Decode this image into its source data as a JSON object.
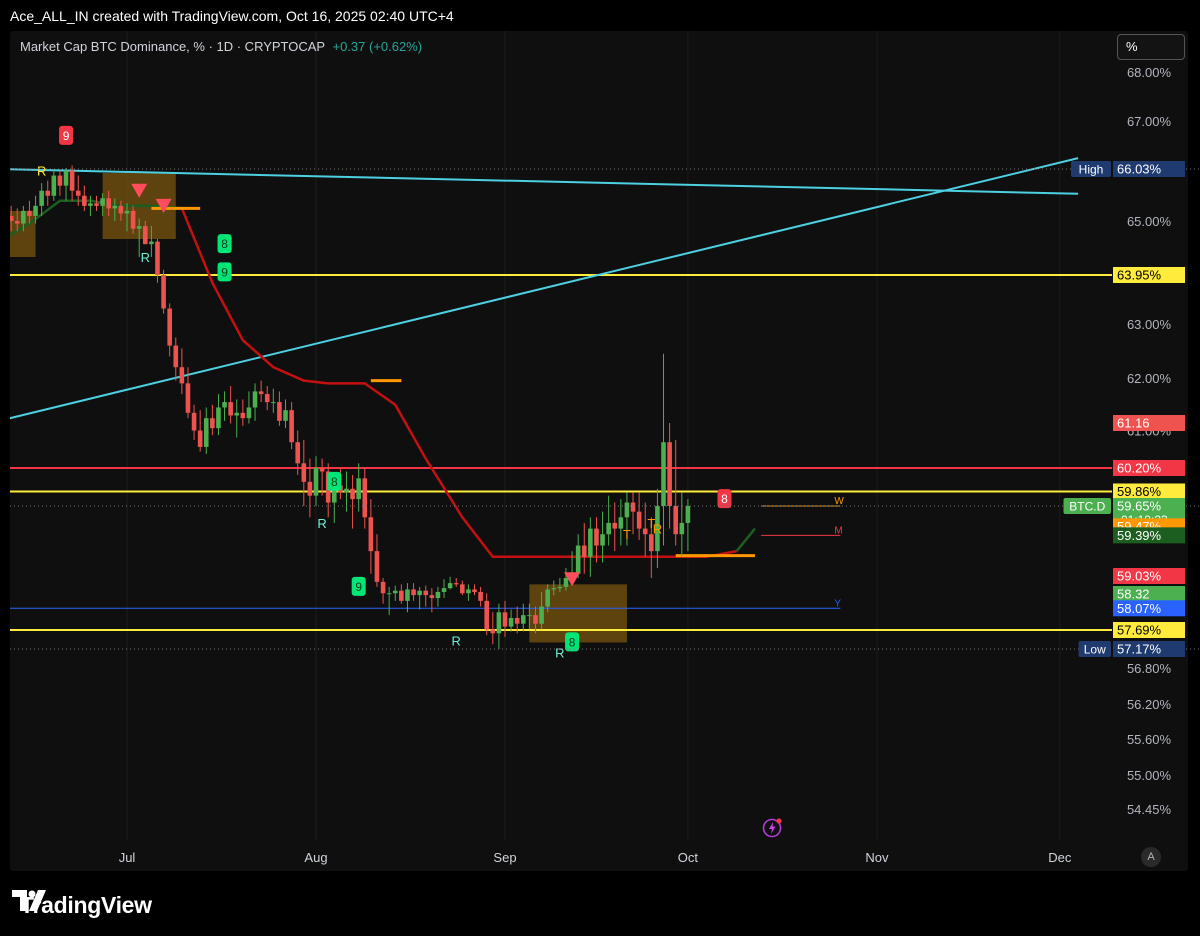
{
  "header": {
    "credit": "Ace_ALL_IN created with TradingView.com, Oct 16, 2025 02:40 UTC+4"
  },
  "legend": {
    "text": "Market Cap BTC Dominance, % · 1D · CRYPTOCAP",
    "change": "+0.37 (+0.62%)"
  },
  "toolbar": {
    "unit_label": "%",
    "auto_label": "A"
  },
  "brand": {
    "name": "TradingView"
  },
  "colors": {
    "background": "#0f0f0f",
    "up": "#4caf50",
    "down": "#ef5350",
    "trendline": "#4dd0e1",
    "yellow_level": "#ffeb3b",
    "red_level": "#f23645",
    "ma_red": "#c41010",
    "ma_green": "#1b5e20",
    "zone": "#7a5510",
    "orange": "#ff9800"
  },
  "chart_data": {
    "type": "candlestick",
    "title": "Market Cap BTC Dominance, % · 1D · CRYPTOCAP",
    "ylabel": "%",
    "ylim": [
      54.2,
      68.3
    ],
    "x_ticks": [
      {
        "date": "2025-07-01",
        "label": "Jul"
      },
      {
        "date": "2025-08-01",
        "label": "Aug"
      },
      {
        "date": "2025-09-01",
        "label": "Sep"
      },
      {
        "date": "2025-10-01",
        "label": "Oct"
      },
      {
        "date": "2025-11-01",
        "label": "Nov"
      },
      {
        "date": "2025-12-01",
        "label": "Dec"
      }
    ],
    "y_ticks": [
      "68.00%",
      "67.00%",
      "65.00%",
      "63.00%",
      "62.00%",
      "61.00%",
      "56.80%",
      "56.20%",
      "55.60%",
      "55.00%",
      "54.45%"
    ],
    "y_tick_values": [
      68.0,
      67.0,
      65.0,
      63.0,
      62.0,
      61.0,
      56.8,
      56.2,
      55.6,
      55.0,
      54.45
    ],
    "price_labels": [
      {
        "value": 66.03,
        "text": "66.03%",
        "tag": "High",
        "color": "#1e3a6e"
      },
      {
        "value": 63.95,
        "text": "63.95%",
        "tag": "",
        "color": "#ffeb3b"
      },
      {
        "value": 61.16,
        "text": "61.16",
        "tag": "",
        "color": "#ef5350"
      },
      {
        "value": 60.2,
        "text": "60.20%",
        "tag": "",
        "color": "#f23645"
      },
      {
        "value": 59.86,
        "text": "59.86%",
        "tag": "",
        "color": "#ffeb3b"
      },
      {
        "value": 59.65,
        "text": "59.65%",
        "tag": "BTC.D",
        "sub": "01:19:23",
        "color": "#4caf50"
      },
      {
        "value": 59.47,
        "text": "59.47%",
        "tag": "",
        "color": "#ff9800"
      },
      {
        "value": 59.39,
        "text": "59.39%",
        "tag": "",
        "color": "#1b5e20"
      },
      {
        "value": 59.03,
        "text": "59.03%",
        "tag": "",
        "color": "#f23645"
      },
      {
        "value": 58.32,
        "text": "58.32",
        "tag": "",
        "color": "#4caf50"
      },
      {
        "value": 58.07,
        "text": "58.07%",
        "tag": "",
        "color": "#2962ff"
      },
      {
        "value": 57.69,
        "text": "57.69%",
        "tag": "",
        "color": "#ffeb3b"
      },
      {
        "value": 57.17,
        "text": "57.17%",
        "tag": "Low",
        "color": "#1e3a6e"
      }
    ],
    "horizontal_levels": [
      {
        "value": 63.95,
        "color": "#ffeb3b"
      },
      {
        "value": 60.2,
        "color": "#f23645"
      },
      {
        "value": 59.86,
        "color": "#ffeb3b"
      },
      {
        "value": 57.69,
        "color": "#ffeb3b"
      }
    ],
    "short_levels": [
      {
        "value": 58.07,
        "from": "2025-06-10",
        "to": "2025-10-26",
        "color": "#2962ff",
        "label": "Y"
      },
      {
        "value": 59.65,
        "from": "2025-10-13",
        "to": "2025-10-26",
        "color": "#ff9800",
        "label": "W"
      },
      {
        "value": 59.39,
        "from": "2025-10-13",
        "to": "2025-10-26",
        "color": "#f23645",
        "label": "M"
      }
    ],
    "dotted_levels": [
      66.03,
      59.65,
      57.17
    ],
    "trendlines": [
      {
        "from": [
          "2025-06-10",
          66.03
        ],
        "to": [
          "2025-12-04",
          65.54
        ],
        "color": "#4dd0e1"
      },
      {
        "from": [
          "2025-06-10",
          61.2
        ],
        "to": [
          "2025-12-04",
          66.25
        ],
        "color": "#4dd0e1"
      }
    ],
    "markers": [
      {
        "date": "2025-06-21",
        "value": 66.7,
        "label": "9",
        "kind": "count_sell"
      },
      {
        "date": "2025-07-17",
        "value": 64.55,
        "label": "8",
        "kind": "count_buy"
      },
      {
        "date": "2025-07-17",
        "value": 64.0,
        "label": "9",
        "kind": "count_buy"
      },
      {
        "date": "2025-08-04",
        "value": 60.0,
        "label": "8",
        "kind": "count_buy"
      },
      {
        "date": "2025-08-08",
        "value": 58.6,
        "label": "9",
        "kind": "count_buy"
      },
      {
        "date": "2025-09-12",
        "value": 57.35,
        "label": "8",
        "kind": "count_buy"
      },
      {
        "date": "2025-10-07",
        "value": 59.75,
        "label": "8",
        "kind": "count_sell"
      },
      {
        "date": "2025-06-17",
        "value": 66.0,
        "label": "R",
        "kind": "letter_yellow"
      },
      {
        "date": "2025-07-04",
        "value": 64.3,
        "label": "R",
        "kind": "letter_teal"
      },
      {
        "date": "2025-08-02",
        "value": 59.5,
        "label": "R",
        "kind": "letter_teal"
      },
      {
        "date": "2025-08-24",
        "value": 57.4,
        "label": "R",
        "kind": "letter_teal"
      },
      {
        "date": "2025-09-10",
        "value": 57.1,
        "label": "R",
        "kind": "letter_teal"
      },
      {
        "date": "2025-09-21",
        "value": 59.4,
        "label": "T",
        "kind": "letter_orange"
      },
      {
        "date": "2025-09-25",
        "value": 59.5,
        "label": "T",
        "kind": "letter_orange"
      },
      {
        "date": "2025-09-26",
        "value": 59.45,
        "label": "R",
        "kind": "letter_orange"
      }
    ],
    "series": [
      {
        "name": "BTC.D",
        "kind": "ohlc",
        "start_date": "2025-06-10",
        "open": [
          64.7,
          64.9,
          65.1,
          65.0,
          64.95,
          65.2,
          65.1,
          65.3,
          65.6,
          65.5,
          65.9,
          65.7,
          66.0,
          65.6,
          65.5,
          65.3,
          65.35,
          65.3,
          65.45,
          65.25,
          65.3,
          65.15,
          65.2,
          64.85,
          64.9,
          64.55,
          64.6,
          63.95,
          63.3,
          62.6,
          62.2,
          61.9,
          61.35,
          61.0,
          60.65,
          61.25,
          61.05,
          61.45,
          61.55,
          61.3,
          61.35,
          61.25,
          61.45,
          61.75,
          61.7,
          61.55,
          61.55,
          61.2,
          61.4,
          60.75,
          60.3,
          60.0,
          59.8,
          60.2,
          60.15,
          59.7,
          59.95,
          59.85,
          59.9,
          59.75,
          60.05,
          59.55,
          59.25,
          58.8,
          58.35,
          58.35,
          58.45,
          58.2,
          58.5,
          58.3,
          58.45,
          58.3,
          58.25,
          58.4,
          58.55,
          58.75,
          58.7,
          58.35,
          58.5,
          58.4,
          58.2,
          57.7,
          57.6,
          58.0,
          57.75,
          57.9,
          57.8,
          57.95,
          57.95,
          57.8,
          58.1,
          58.5,
          58.55,
          58.6,
          58.95,
          59.05,
          59.3,
          59.2,
          59.45,
          59.3,
          59.4,
          59.5,
          59.45,
          59.55,
          59.7,
          59.6,
          59.45,
          59.4,
          59.25,
          59.65,
          60.75,
          59.65,
          59.4,
          59.5
        ],
        "high": [
          64.9,
          65.15,
          65.3,
          65.25,
          65.3,
          65.4,
          65.5,
          65.75,
          65.8,
          66.03,
          66.0,
          66.05,
          66.1,
          65.9,
          65.7,
          65.5,
          65.5,
          65.55,
          65.6,
          65.45,
          65.4,
          65.35,
          65.3,
          65.05,
          65.0,
          64.9,
          64.65,
          64.05,
          63.4,
          62.75,
          62.55,
          62.2,
          61.5,
          61.4,
          61.45,
          61.5,
          61.7,
          61.75,
          61.85,
          61.6,
          61.6,
          61.75,
          61.9,
          61.95,
          61.85,
          61.8,
          61.75,
          61.6,
          61.55,
          61.0,
          60.8,
          60.4,
          60.45,
          60.4,
          60.3,
          60.1,
          60.2,
          60.15,
          60.1,
          60.3,
          60.2,
          59.75,
          59.4,
          58.95,
          58.6,
          58.65,
          58.7,
          58.75,
          58.75,
          58.6,
          58.65,
          58.55,
          58.6,
          58.9,
          59.0,
          58.95,
          58.85,
          58.7,
          58.7,
          58.6,
          58.35,
          58.0,
          58.15,
          58.2,
          58.05,
          58.1,
          58.15,
          58.15,
          58.1,
          58.4,
          58.7,
          58.85,
          58.95,
          59.1,
          59.25,
          59.4,
          59.5,
          59.55,
          59.55,
          59.6,
          59.8,
          59.7,
          59.75,
          59.85,
          59.85,
          59.85,
          59.7,
          59.55,
          59.9,
          62.45,
          61.16,
          60.8,
          59.85,
          59.75
        ],
        "low": [
          64.4,
          64.6,
          64.8,
          64.8,
          64.8,
          64.95,
          64.95,
          65.1,
          65.3,
          65.4,
          65.5,
          65.4,
          65.4,
          65.3,
          65.2,
          65.1,
          65.2,
          65.1,
          65.1,
          65.0,
          65.0,
          64.8,
          64.75,
          64.3,
          64.55,
          64.3,
          63.8,
          63.2,
          62.4,
          61.95,
          61.7,
          61.25,
          60.8,
          60.55,
          60.5,
          60.9,
          60.9,
          61.2,
          61.15,
          60.85,
          61.1,
          61.15,
          61.2,
          61.55,
          61.4,
          61.35,
          61.1,
          61.05,
          60.6,
          60.1,
          59.65,
          59.55,
          59.65,
          59.8,
          59.55,
          59.5,
          59.75,
          59.6,
          59.45,
          59.6,
          59.45,
          59.05,
          58.6,
          58.15,
          57.95,
          58.2,
          58.15,
          58.0,
          58.2,
          58.05,
          58.1,
          58.0,
          58.1,
          58.25,
          58.5,
          58.6,
          58.3,
          58.2,
          58.3,
          58.1,
          57.55,
          57.3,
          57.17,
          57.5,
          57.65,
          57.6,
          57.65,
          57.7,
          57.6,
          57.7,
          58.0,
          58.3,
          58.4,
          58.45,
          58.8,
          58.95,
          59.05,
          59.0,
          59.15,
          59.15,
          59.3,
          59.25,
          59.3,
          59.3,
          59.4,
          59.35,
          59.2,
          58.95,
          59.1,
          59.3,
          59.45,
          59.3,
          59.2,
          59.25
        ],
        "close": [
          64.9,
          65.1,
          65.0,
          64.95,
          65.2,
          65.1,
          65.3,
          65.6,
          65.5,
          65.9,
          65.7,
          66.0,
          65.6,
          65.5,
          65.3,
          65.35,
          65.3,
          65.45,
          65.25,
          65.3,
          65.15,
          65.2,
          64.85,
          64.9,
          64.55,
          64.6,
          63.95,
          63.3,
          62.6,
          62.2,
          61.9,
          61.35,
          61.0,
          60.65,
          61.25,
          61.05,
          61.45,
          61.55,
          61.3,
          61.35,
          61.25,
          61.45,
          61.75,
          61.7,
          61.55,
          61.55,
          61.2,
          61.4,
          60.75,
          60.3,
          60.0,
          59.8,
          60.2,
          60.15,
          59.7,
          59.95,
          59.85,
          59.9,
          59.75,
          60.05,
          59.55,
          59.25,
          58.8,
          58.35,
          58.35,
          58.45,
          58.2,
          58.5,
          58.3,
          58.45,
          58.3,
          58.25,
          58.4,
          58.55,
          58.75,
          58.7,
          58.35,
          58.5,
          58.4,
          58.2,
          57.7,
          57.6,
          58.0,
          57.75,
          57.9,
          57.8,
          57.95,
          57.95,
          57.8,
          58.1,
          58.5,
          58.55,
          58.6,
          58.95,
          59.05,
          59.3,
          59.2,
          59.45,
          59.3,
          59.4,
          59.5,
          59.45,
          59.55,
          59.7,
          59.6,
          59.45,
          59.4,
          59.25,
          59.65,
          60.75,
          59.65,
          59.4,
          59.5,
          59.65
        ]
      }
    ],
    "indicators": [
      {
        "name": "ma",
        "dates": [
          "2025-06-10",
          "2025-06-15",
          "2025-06-20",
          "2025-06-25",
          "2025-06-30",
          "2025-07-05",
          "2025-07-10",
          "2025-07-15",
          "2025-07-20",
          "2025-07-25",
          "2025-07-30",
          "2025-08-03",
          "2025-08-09",
          "2025-08-14",
          "2025-08-19",
          "2025-08-25",
          "2025-08-30",
          "2025-09-04",
          "2025-09-09",
          "2025-09-14",
          "2025-09-19",
          "2025-09-24",
          "2025-09-29",
          "2025-10-04",
          "2025-10-09",
          "2025-10-12"
        ],
        "values": [
          64.6,
          64.95,
          65.4,
          65.4,
          65.3,
          65.3,
          65.25,
          63.8,
          62.7,
          62.2,
          61.95,
          61.9,
          61.9,
          61.5,
          60.4,
          59.55,
          59.2,
          59.2,
          59.2,
          59.2,
          59.2,
          59.2,
          59.2,
          59.2,
          59.25,
          59.45
        ]
      },
      {
        "name": "stop_zone_1",
        "from": "2025-06-10",
        "to": "2025-06-16",
        "low": 64.3,
        "high": 65.2
      },
      {
        "name": "stop_zone_2",
        "from": "2025-06-27",
        "to": "2025-07-09",
        "low": 64.65,
        "high": 65.95
      },
      {
        "name": "stop_zone_3",
        "from": "2025-09-05",
        "to": "2025-09-21",
        "low": 57.35,
        "high": 58.7
      },
      {
        "name": "stop_line_1",
        "from": "2025-07-05",
        "to": "2025-07-13",
        "value": 65.25
      },
      {
        "name": "stop_line_2",
        "from": "2025-08-10",
        "to": "2025-08-15",
        "value": 61.95
      },
      {
        "name": "stop_line_3",
        "from": "2025-09-29",
        "to": "2025-10-12",
        "value": 59.21
      },
      {
        "name": "triangle_1",
        "date": "2025-07-03",
        "value": 65.6
      },
      {
        "name": "triangle_2",
        "date": "2025-07-07",
        "value": 65.3
      },
      {
        "name": "triangle_3",
        "date": "2025-09-12",
        "value": 58.9
      }
    ]
  }
}
